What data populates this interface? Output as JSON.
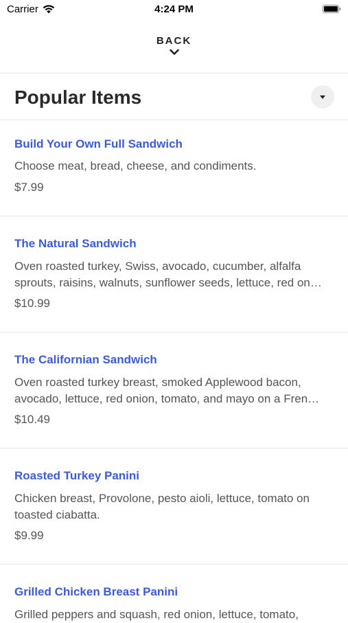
{
  "status_bar": {
    "carrier": "Carrier",
    "time": "4:24 PM",
    "wifi_icon": "wifi-icon",
    "battery_icon": "battery-icon"
  },
  "nav": {
    "back_label": "BACK",
    "chevron_icon": "chevron-down-icon"
  },
  "header": {
    "title": "Popular Items",
    "dropdown_icon": "caret-down-icon"
  },
  "colors": {
    "item_name": "#3d5bd8",
    "text_secondary": "#555555",
    "divider": "#e6e6e6"
  },
  "items": [
    {
      "name": "Build Your Own Full Sandwich",
      "description_lines": [
        "Choose meat, bread, cheese, and condiments."
      ],
      "price": "$7.99"
    },
    {
      "name": "The Natural Sandwich",
      "description_lines": [
        "Oven roasted turkey, Swiss, avocado, cucumber, alfalfa",
        "sprouts, raisins, walnuts, sunflower seeds, lettuce, red on…"
      ],
      "price": "$10.99"
    },
    {
      "name": "The Californian Sandwich",
      "description_lines": [
        "Oven roasted turkey breast, smoked Applewood bacon,",
        "avocado, lettuce, red onion, tomato, and mayo on a Fren…"
      ],
      "price": "$10.49"
    },
    {
      "name": "Roasted Turkey Panini",
      "description_lines": [
        "Chicken breast, Provolone, pesto aioli, lettuce, tomato on",
        "toasted ciabatta."
      ],
      "price": "$9.99"
    },
    {
      "name": "Grilled Chicken Breast Panini",
      "description_lines": [
        "Grilled peppers and squash, red onion, lettuce, tomato,"
      ],
      "price": ""
    }
  ]
}
